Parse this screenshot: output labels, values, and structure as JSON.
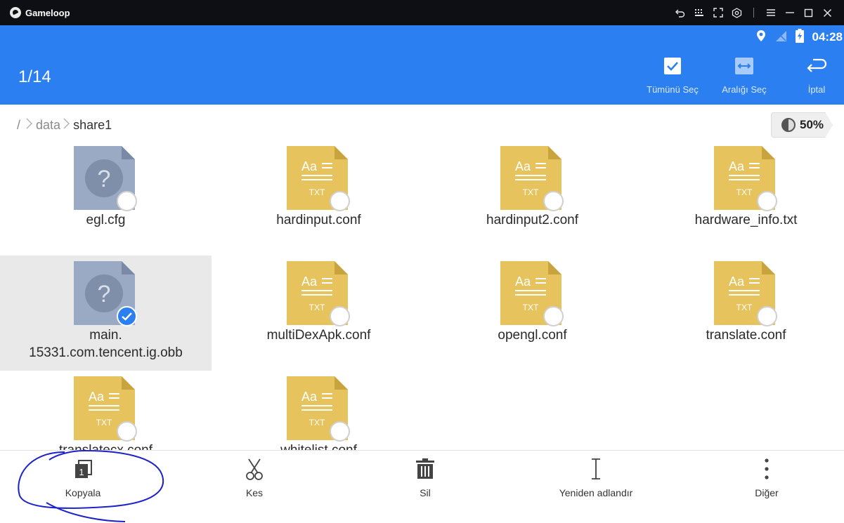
{
  "window": {
    "app_title": "Gameloop",
    "controls": [
      "back-icon",
      "keyboard-icon",
      "fullscreen-icon",
      "screenshot-icon",
      "menu-icon",
      "minimize-icon",
      "maximize-icon",
      "close-icon"
    ]
  },
  "statusbar": {
    "time": "04:28",
    "icons": [
      "location-icon",
      "no-signal-icon",
      "battery-charging-icon"
    ]
  },
  "header": {
    "selection_count": "1/14",
    "actions": [
      {
        "label": "Tümünü Seç",
        "icon": "select-all-icon"
      },
      {
        "label": "Aralığı Seç",
        "icon": "select-range-icon"
      },
      {
        "label": "İptal",
        "icon": "cancel-icon"
      }
    ],
    "accent_color": "#2c7ff0"
  },
  "breadcrumb": {
    "root": "/",
    "items": [
      "data",
      "share1"
    ]
  },
  "storage": {
    "percent_label": "50%",
    "used_fraction": 0.5
  },
  "files": [
    {
      "name": "egl.cfg",
      "type": "unknown",
      "selected": false
    },
    {
      "name": "hardinput.conf",
      "type": "txt",
      "selected": false
    },
    {
      "name": "hardinput2.conf",
      "type": "txt",
      "selected": false
    },
    {
      "name": "hardware_info.txt",
      "type": "txt",
      "selected": false
    },
    {
      "name": "main.\n15331.com.tencent.ig.obb",
      "type": "unknown",
      "selected": true
    },
    {
      "name": "multiDexApk.conf",
      "type": "txt",
      "selected": false
    },
    {
      "name": "opengl.conf",
      "type": "txt",
      "selected": false
    },
    {
      "name": "translate.conf",
      "type": "txt",
      "selected": false
    },
    {
      "name": "translatecx.conf",
      "type": "txt",
      "selected": false
    },
    {
      "name": "whitelist.conf",
      "type": "txt",
      "selected": false
    }
  ],
  "file_icon_labels": {
    "txt_top": "Aa",
    "txt_bottom": "TXT",
    "unknown": "?"
  },
  "bottom_actions": [
    {
      "label": "Kopyala",
      "icon": "copy-icon"
    },
    {
      "label": "Kes",
      "icon": "scissors-icon"
    },
    {
      "label": "Sil",
      "icon": "trash-icon"
    },
    {
      "label": "Yeniden adlandır",
      "icon": "rename-cursor-icon"
    },
    {
      "label": "Diğer",
      "icon": "more-vertical-icon"
    }
  ]
}
